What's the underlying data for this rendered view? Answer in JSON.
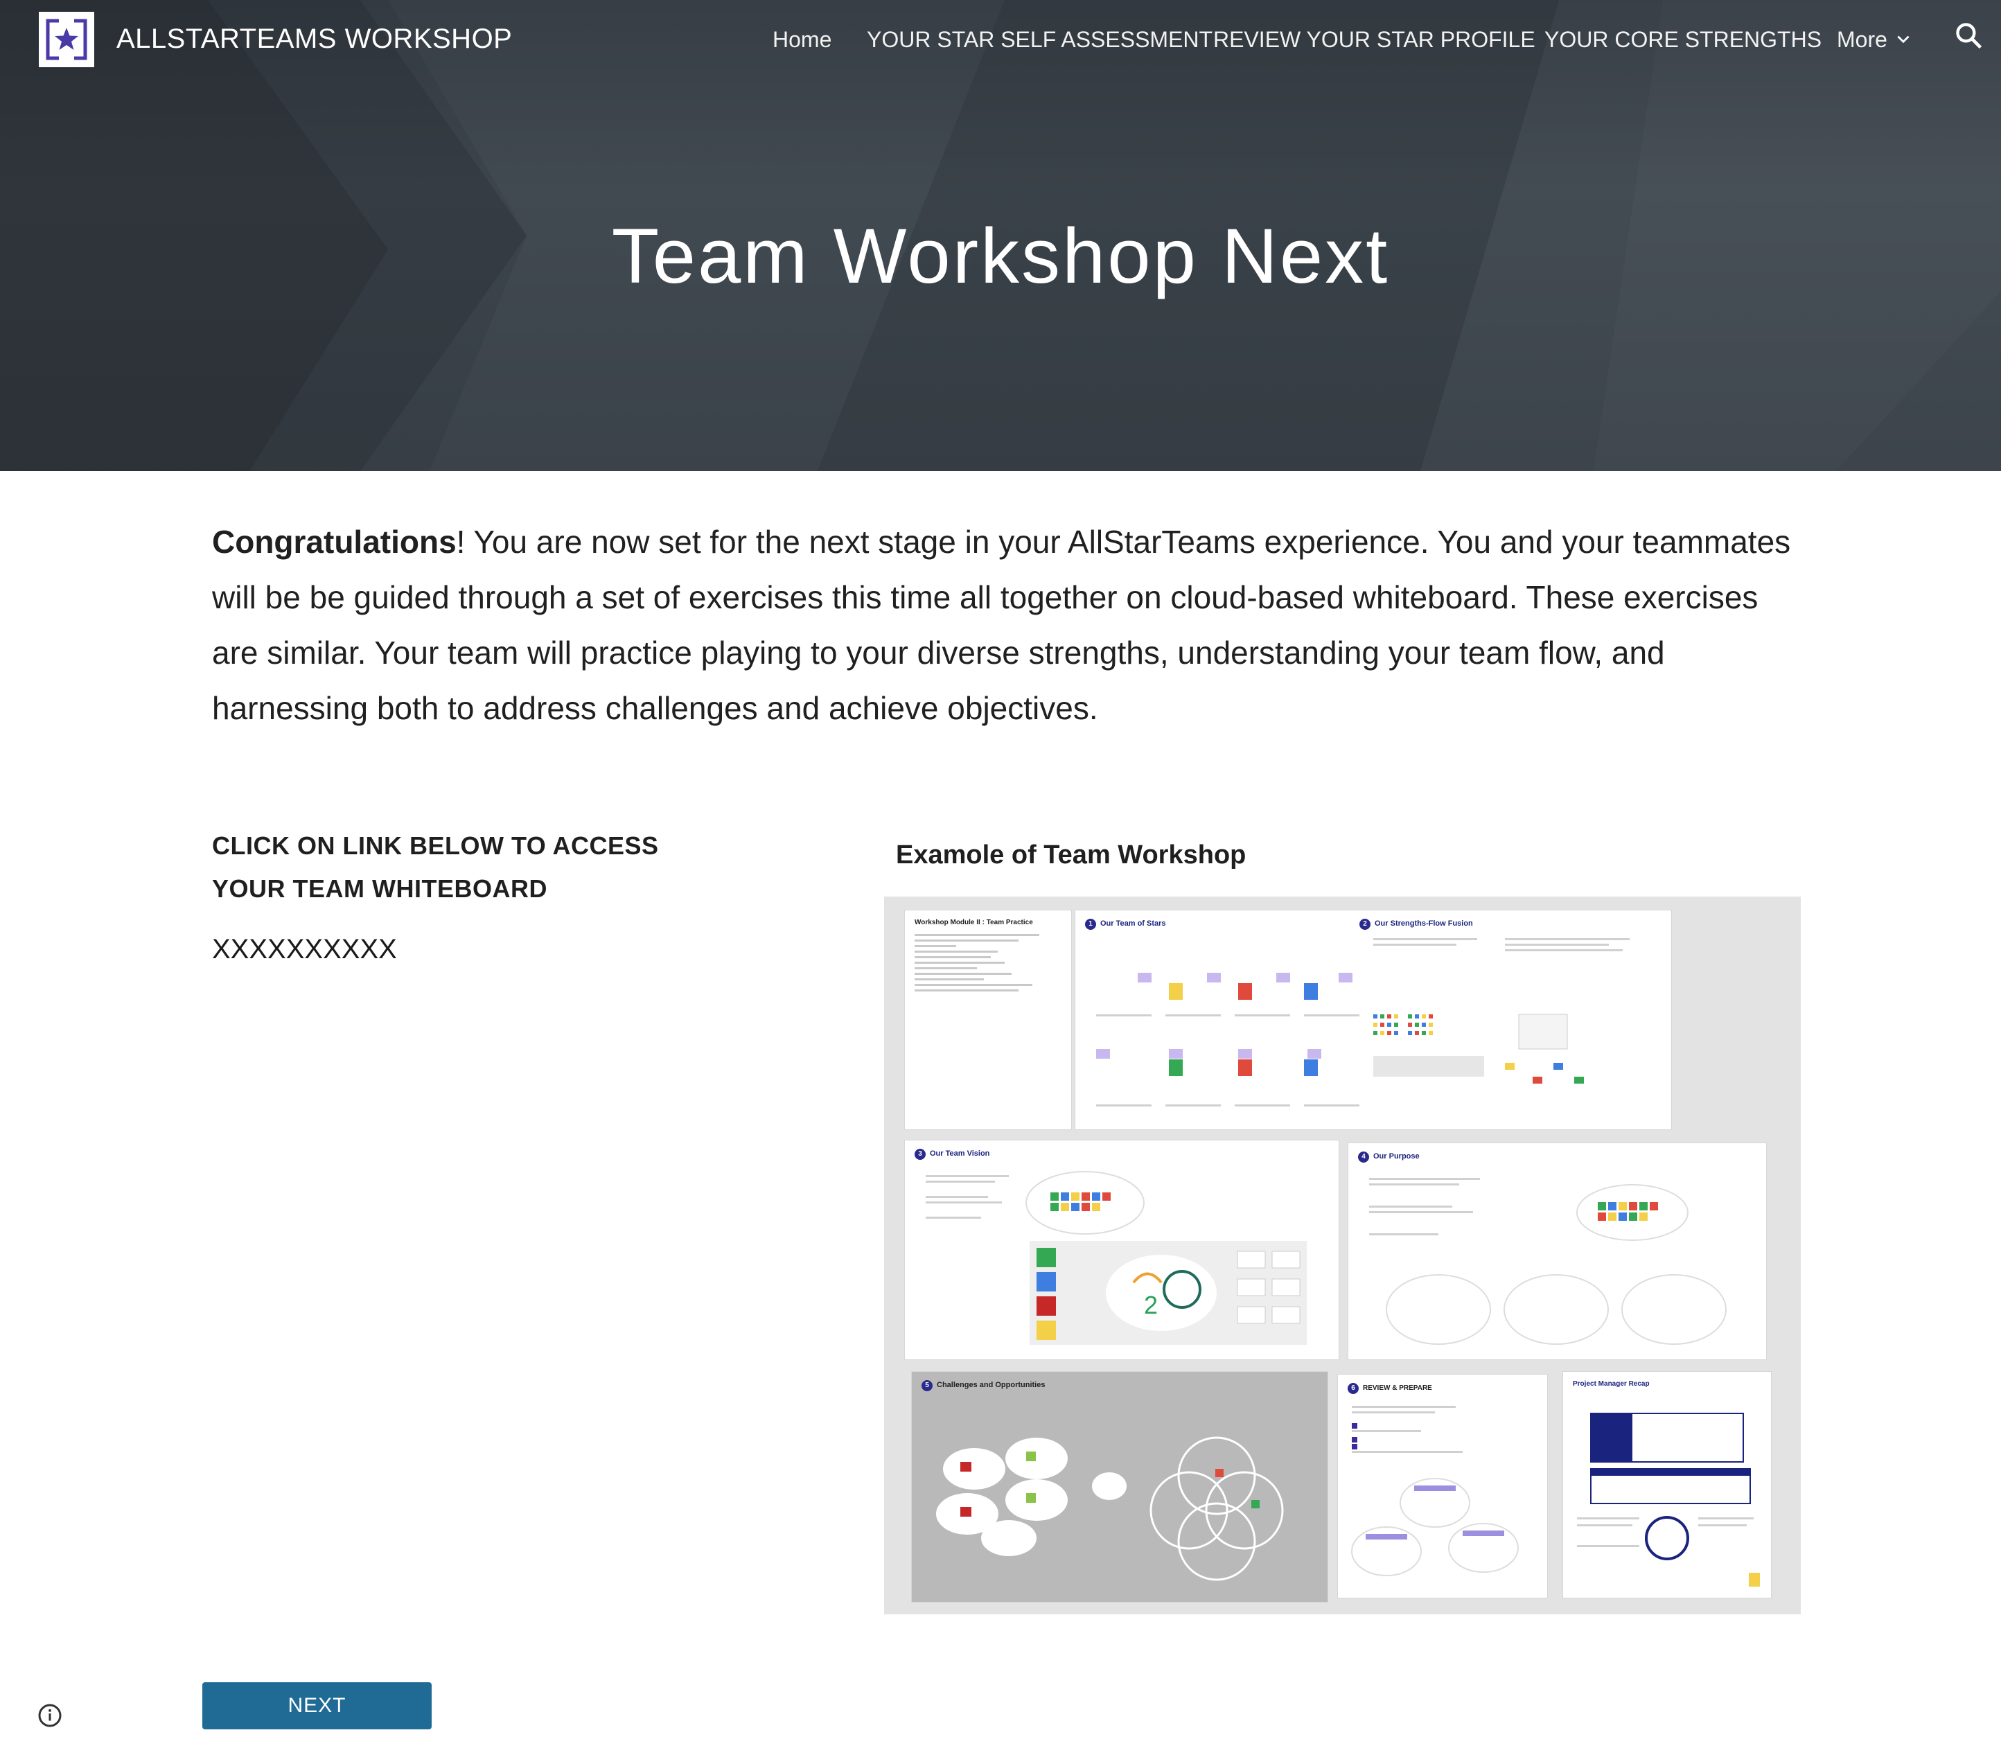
{
  "header": {
    "site_title": "ALLSTARTEAMS WORKSHOP",
    "nav": [
      {
        "label": "Home"
      },
      {
        "label": "YOUR STAR SELF ASSESSMENT"
      },
      {
        "label": "REVIEW YOUR STAR PROFILE"
      },
      {
        "label": "YOUR CORE STRENGTHS"
      },
      {
        "label": "More"
      }
    ],
    "logo_icon": "star-logo-icon",
    "search_icon": "search-icon",
    "more_icon": "chevron-down-icon"
  },
  "hero": {
    "title": "Team Workshop Next"
  },
  "intro": {
    "bold": "Congratulations",
    "rest": "! You are now set for the next stage in your AllStarTeams experience. You and your teammates will be be guided through a set of exercises this time all together on cloud-based whiteboard. These exercises are similar. Your team will  practice playing to your diverse strengths, understanding your team flow, and harnessing both to address challenges and achieve objectives."
  },
  "cta": {
    "heading": "CLICK ON LINK BELOW TO ACCESS YOUR TEAM WHITEBOARD",
    "link": "XXXXXXXXXX"
  },
  "example": {
    "heading": "Examole of Team Workshop",
    "frames": {
      "f0": "Workshop Module II : Team Practice",
      "f1": "Our Team of Stars",
      "f2": "Our Strengths-Flow Fusion",
      "f3": "Our Team Vision",
      "f4": "Our Purpose",
      "f5": "Challenges and Opportunities",
      "f6": "REVIEW & PREPARE",
      "f7": "Project Manager Recap"
    },
    "frame_numbers": [
      "1",
      "2",
      "3",
      "4",
      "5",
      "6"
    ]
  },
  "footer": {
    "next_label": "NEXT",
    "info_icon": "info-icon"
  },
  "colors": {
    "hero_bg": "#3b434b",
    "button_bg": "#1f6b96",
    "logo_accent": "#4a3aa8"
  }
}
